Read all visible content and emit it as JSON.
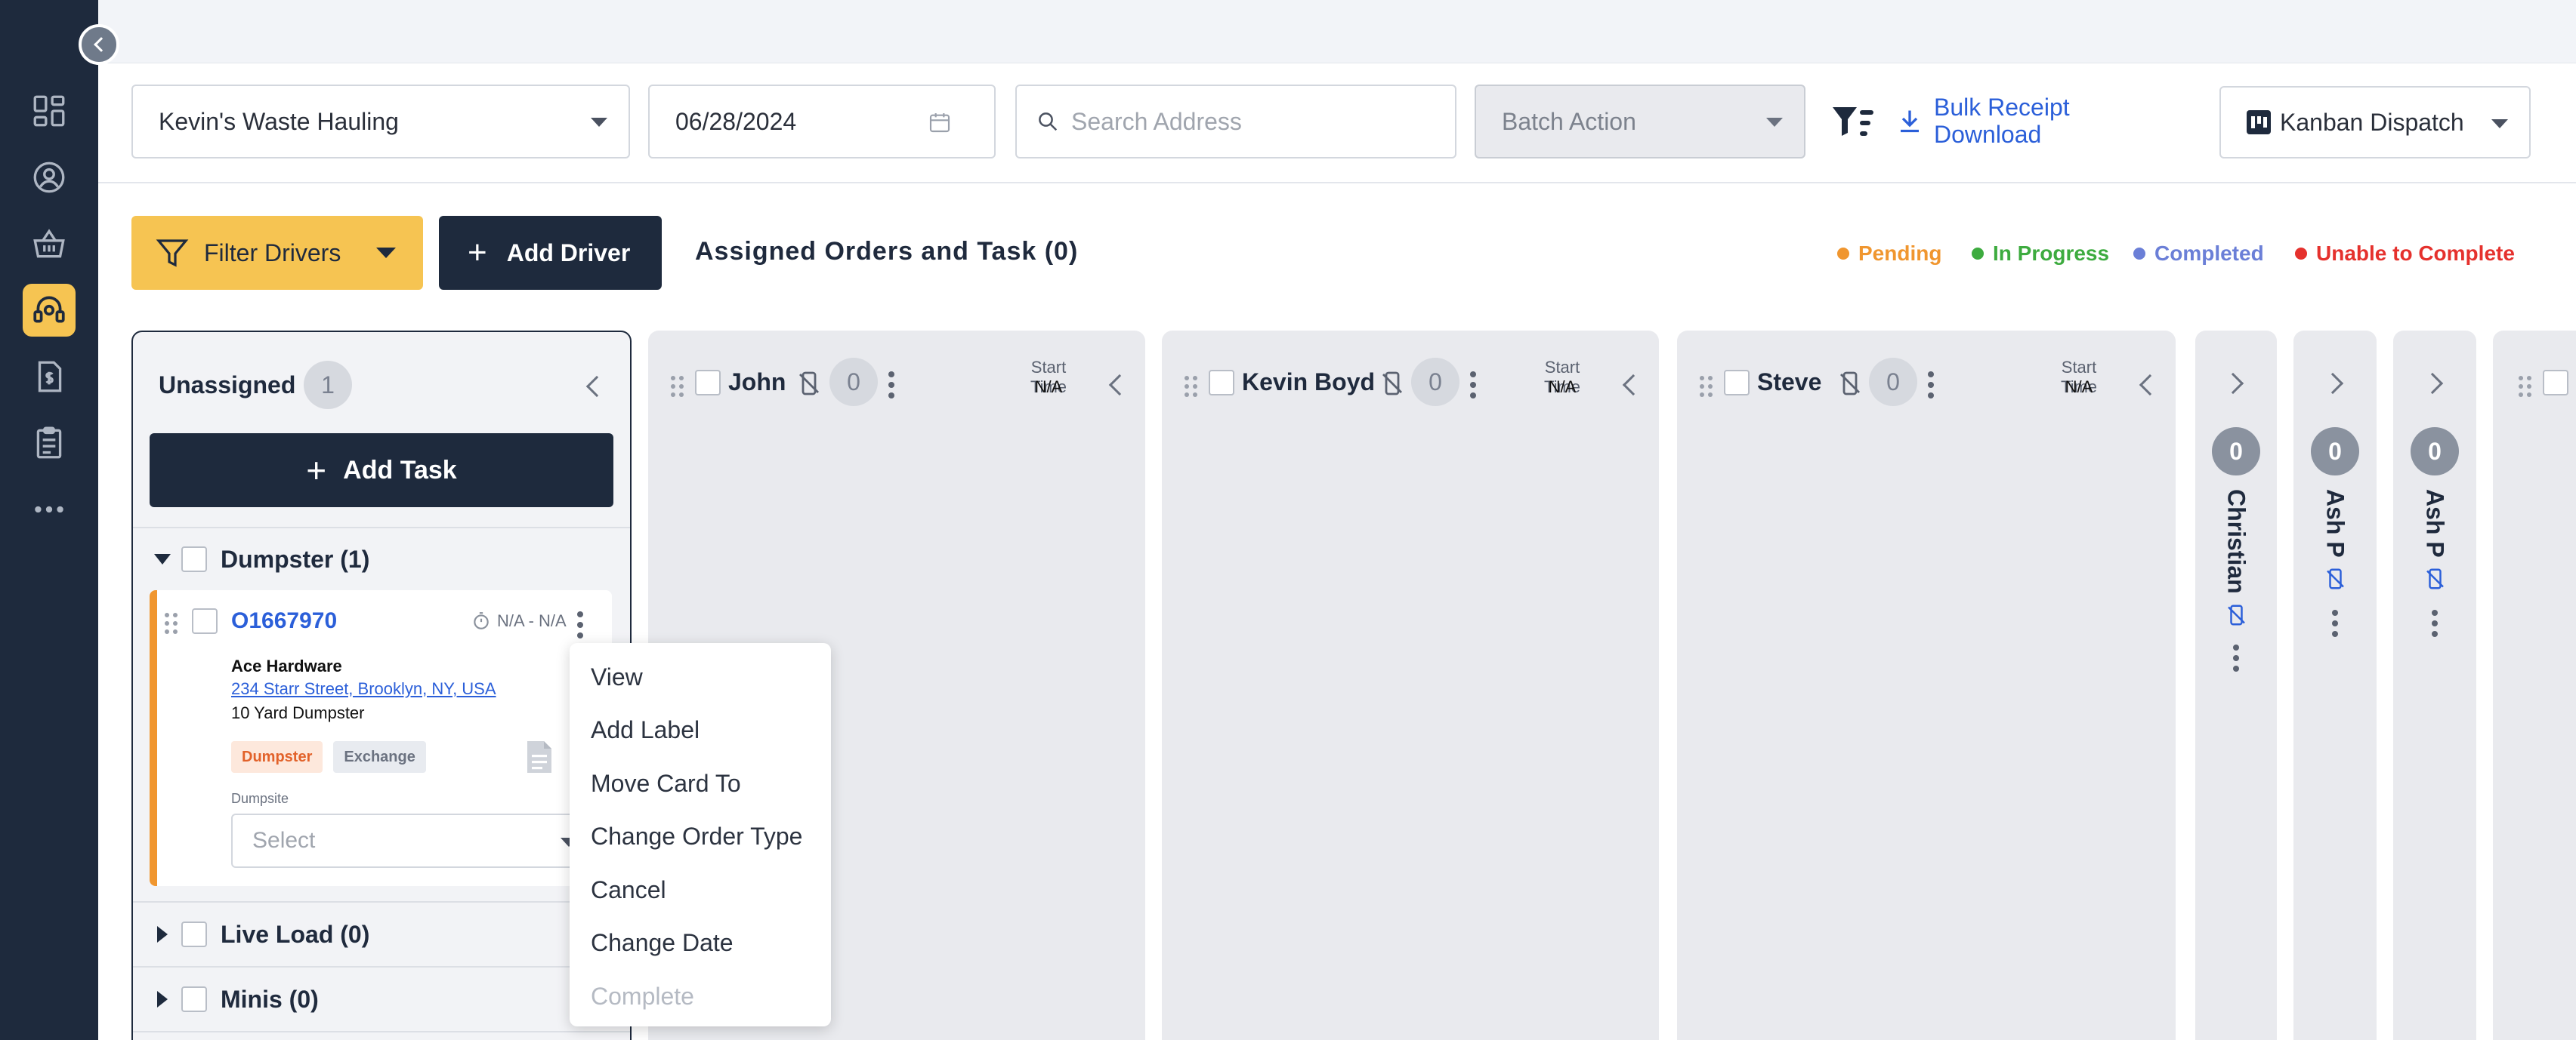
{
  "header": {
    "company_select": "Kevin's Waste Hauling",
    "date_value": "06/28/2024",
    "search_placeholder": "Search Address",
    "batch_action": "Batch Action",
    "bulk_receipt_line1": "Bulk Receipt",
    "bulk_receipt_line2": "Download",
    "view_select": "Kanban Dispatch"
  },
  "toolbar": {
    "filter_drivers": "Filter Drivers",
    "add_driver": "Add Driver",
    "assigned_title": "Assigned Orders and Task (0)"
  },
  "legend": [
    {
      "label": "Pending",
      "color": "#f0962f"
    },
    {
      "label": "In Progress",
      "color": "#3dab3f"
    },
    {
      "label": "Completed",
      "color": "#6b7fd7"
    },
    {
      "label": "Unable to Complete",
      "color": "#e5312d"
    }
  ],
  "unassigned": {
    "title": "Unassigned",
    "count": "1",
    "add_task": "Add Task",
    "groups": [
      {
        "label": "Dumpster (1)"
      },
      {
        "label": "Live Load (0)"
      },
      {
        "label": "Minis (0)"
      }
    ],
    "card": {
      "order_id": "O1667970",
      "time_range": "N/A - N/A",
      "customer": "Ace Hardware",
      "address": "234 Starr Street, Brooklyn, NY, USA",
      "product": "10 Yard Dumpster",
      "tag1": "Dumpster",
      "tag2": "Exchange",
      "dumpsite_label": "Dumpsite",
      "dumpsite_placeholder": "Select",
      "accent": "#f0962f"
    }
  },
  "drivers": [
    {
      "name": "John",
      "count": "0",
      "start_label": "Start Time",
      "start_value": "N/A"
    },
    {
      "name": "Kevin Boyd",
      "count": "0",
      "start_label": "Start Time",
      "start_value": "N/A"
    },
    {
      "name": "Steve",
      "count": "0",
      "start_label": "Start Time",
      "start_value": "N/A"
    }
  ],
  "collapsed_drivers": [
    {
      "name": "Christian",
      "count": "0"
    },
    {
      "name": "Ash P",
      "count": "0"
    },
    {
      "name": "Ash P",
      "count": "0"
    }
  ],
  "context_menu": {
    "items": [
      {
        "label": "View",
        "enabled": true
      },
      {
        "label": "Add Label",
        "enabled": true
      },
      {
        "label": "Move Card To",
        "enabled": true
      },
      {
        "label": "Change Order Type",
        "enabled": true
      },
      {
        "label": "Cancel",
        "enabled": true
      },
      {
        "label": "Change Date",
        "enabled": true
      },
      {
        "label": "Complete",
        "enabled": false
      }
    ]
  },
  "colors": {
    "sidebar": "#1e2a3d",
    "accent_yellow": "#f6c452",
    "link_blue": "#2b5fd9"
  }
}
